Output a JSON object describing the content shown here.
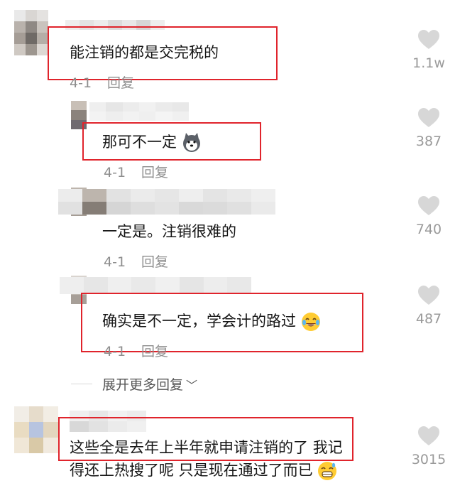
{
  "comments": [
    {
      "text": "能注销的都是交完税的",
      "date": "4-1",
      "reply_label": "回复",
      "likes": "1.1w"
    },
    {
      "text": "那可不一定",
      "emoji": "husky-dog-emoji",
      "date": "4-1",
      "reply_label": "回复",
      "likes": "387"
    },
    {
      "text": "一定是。注销很难的",
      "date": "4-1",
      "reply_label": "回复",
      "likes": "740"
    },
    {
      "text": "确实是不一定，学会计的路过",
      "emoji": "laugh-cry-emoji",
      "date": "4-1",
      "reply_label": "回复",
      "likes": "487"
    },
    {
      "text_line1_highlighted": "这些全是去年上半年就申请注销的了",
      "text_line1_rest": "我记",
      "text_line2": "得还上热搜了呢 只是现在通过了而已",
      "emoji": "grin-sweat-emoji",
      "likes": "3015"
    }
  ],
  "expand_replies": {
    "label": "展开更多回复",
    "icon": "chevron-down-icon"
  },
  "colors": {
    "highlight_border": "#e0242c",
    "meta_text": "#8e8e8e",
    "heart": "#d7d7d7"
  }
}
